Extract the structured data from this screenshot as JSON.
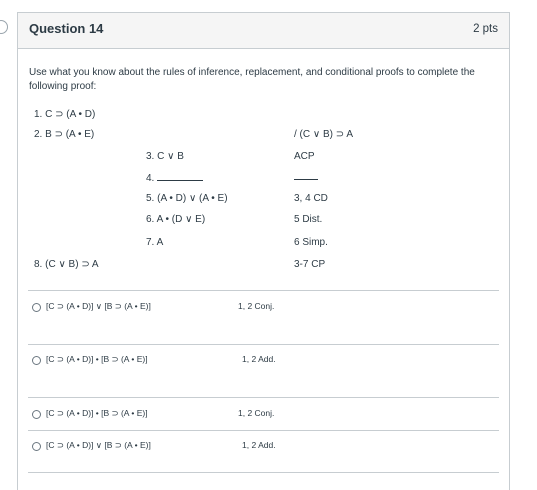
{
  "question": {
    "title": "Question 14",
    "points": "2 pts",
    "prompt": "Use what you know about the rules of inference, replacement, and conditional proofs to complete the following proof:"
  },
  "proof": {
    "line1": "1. C ⊃ (A • D)",
    "line2": "2. B ⊃ (A • E)",
    "conclusion": "/ (C ∨ B) ⊃ A",
    "line3": "3. C ∨ B",
    "just3": "ACP",
    "line4": "4.",
    "line5": "5. (A • D) ∨ (A • E)",
    "just5": "3, 4 CD",
    "line6": "6. A • (D ∨ E)",
    "just6": "5 Dist.",
    "line7": "7. A",
    "just7": "6 Simp.",
    "line8": "8. (C ∨ B) ⊃ A",
    "just8": "3-7 CP"
  },
  "answers": [
    {
      "text": "[C ⊃ (A • D)] ∨ [B ⊃ (A • E)]",
      "rule": "1, 2 Conj."
    },
    {
      "text": "[C ⊃ (A • D)] • [B ⊃ (A • E)]",
      "rule": "1, 2 Add."
    },
    {
      "text": "[C ⊃ (A • D)] • [B ⊃ (A • E)]",
      "rule": "1, 2 Conj."
    },
    {
      "text": "[C ⊃ (A • D)] ∨ [B ⊃ (A • E)]",
      "rule": "1, 2 Add."
    }
  ]
}
